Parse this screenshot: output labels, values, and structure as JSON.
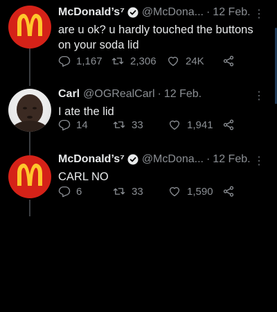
{
  "tweets": [
    {
      "name": "McDonald’s",
      "name_mark": "⁷",
      "handle": "@McDona...",
      "date": "12 Feb.",
      "text": "are u ok? u hardly touched the buttons on your soda lid",
      "replies": "1,167",
      "retweets": "2,306",
      "likes": "24K",
      "avatar": "mcdonalds-logo",
      "verified": true
    },
    {
      "name": "Carl",
      "handle": "@OGRealCarl",
      "date": "12 Feb.",
      "text": "I ate the lid",
      "replies": "14",
      "retweets": "33",
      "likes": "1,941",
      "avatar": "carl-photo",
      "verified": false
    },
    {
      "name": "McDonald’s",
      "name_mark": "⁷",
      "handle": "@McDona...",
      "date": "12 Feb.",
      "text": "CARL NO",
      "replies": "6",
      "retweets": "33",
      "likes": "1,590",
      "avatar": "mcdonalds-logo",
      "verified": true
    }
  ],
  "separator": "·",
  "more_glyph": "⋮",
  "colors": {
    "background": "#000000",
    "text": "#e7e9ea",
    "muted": "#8b8f94",
    "mcdonalds_red": "#d52218",
    "mcdonalds_yellow": "#ffc72c",
    "verified_badge": "#e7e9ea"
  }
}
